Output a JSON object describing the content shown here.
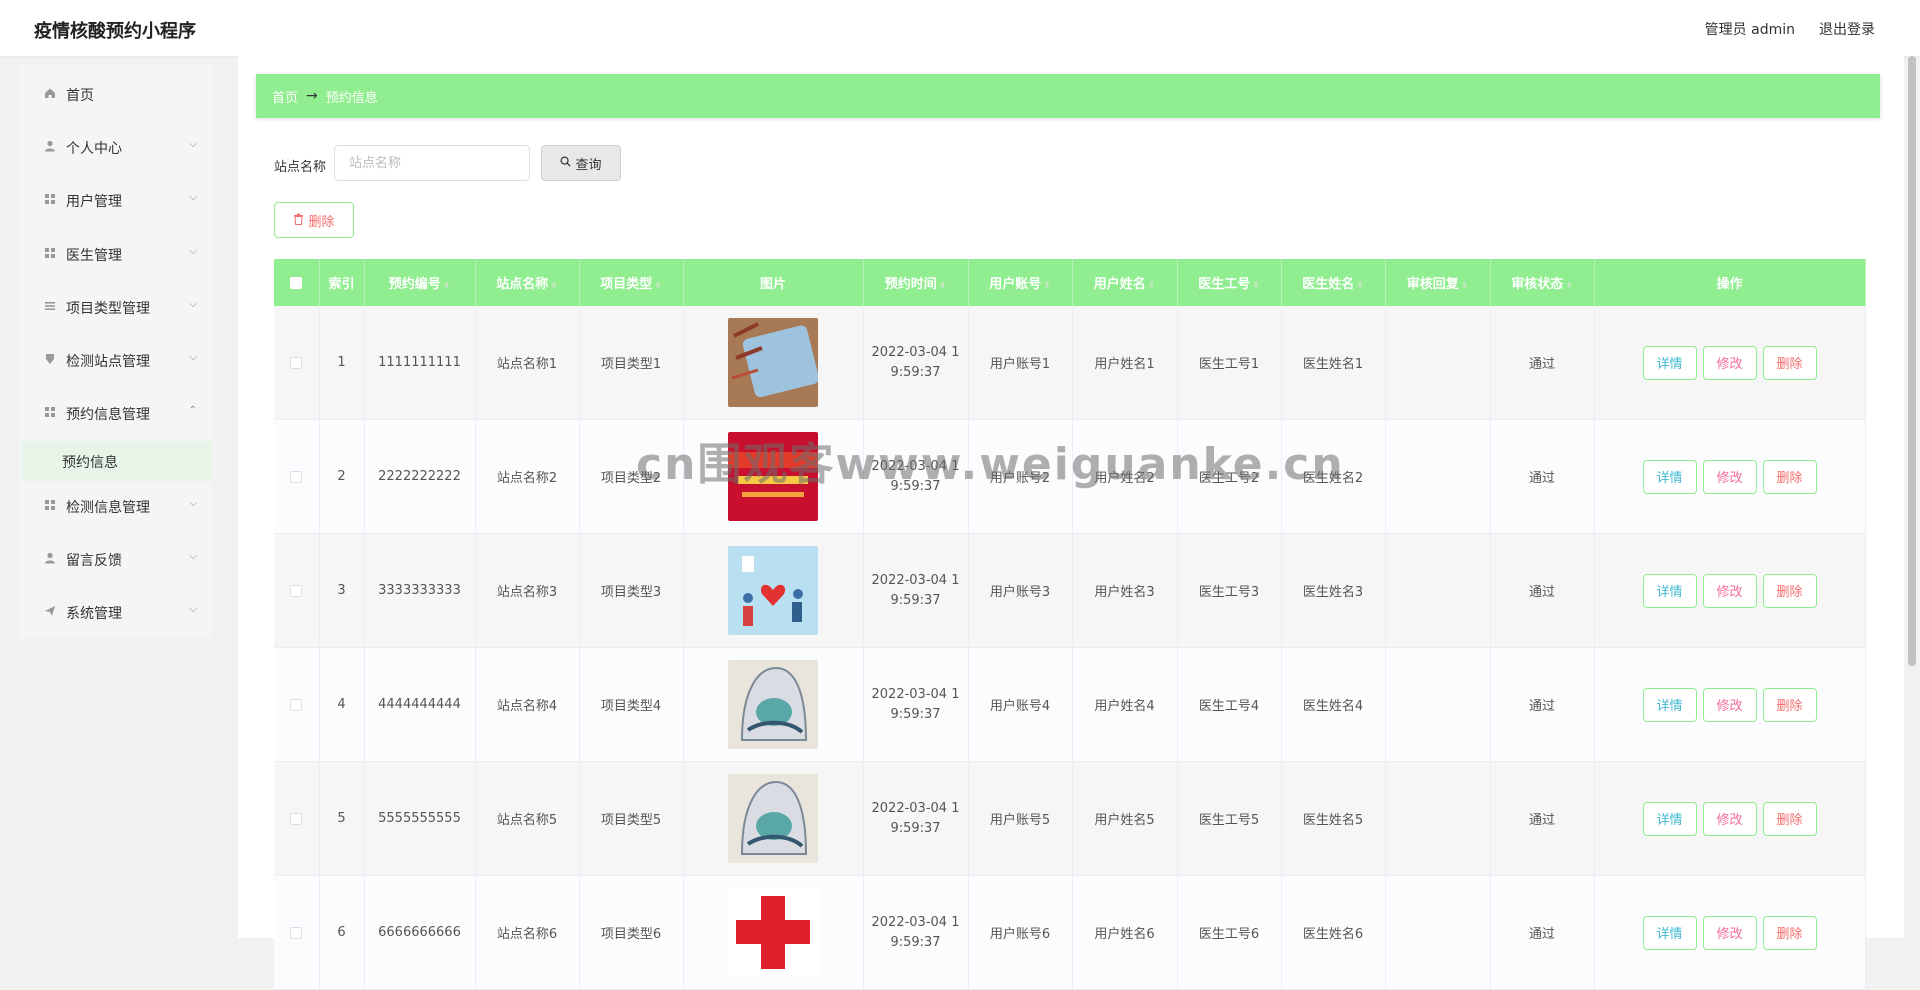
{
  "app_title": "疫情核酸预约小程序",
  "header": {
    "user": "管理员 admin",
    "logout": "退出登录"
  },
  "sidebar": {
    "items": [
      {
        "label": "首页",
        "icon": "home-icon"
      },
      {
        "label": "个人中心",
        "icon": "user-icon"
      },
      {
        "label": "用户管理",
        "icon": "grid-icon"
      },
      {
        "label": "医生管理",
        "icon": "grid-icon"
      },
      {
        "label": "项目类型管理",
        "icon": "list-icon"
      },
      {
        "label": "检测站点管理",
        "icon": "pin-icon"
      },
      {
        "label": "预约信息管理",
        "icon": "grid-icon"
      },
      {
        "label": "检测信息管理",
        "icon": "grid-icon"
      },
      {
        "label": "留言反馈",
        "icon": "user-icon"
      },
      {
        "label": "系统管理",
        "icon": "send-icon"
      }
    ],
    "active_sub": "预约信息"
  },
  "breadcrumb": {
    "home": "首页",
    "current": "预约信息"
  },
  "search": {
    "label": "站点名称",
    "placeholder": "站点名称",
    "button": "查询"
  },
  "toolbar": {
    "delete_label": "删除"
  },
  "table": {
    "headers": [
      "索引",
      "预约编号",
      "站点名称",
      "项目类型",
      "图片",
      "预约时间",
      "用户账号",
      "用户姓名",
      "医生工号",
      "医生姓名",
      "审核回复",
      "审核状态",
      "操作"
    ],
    "rows": [
      {
        "index": "1",
        "order_no": "1111111111",
        "site": "站点名称1",
        "type": "项目类型1",
        "time1": "2022-03-04 1",
        "time2": "9:59:37",
        "account": "用户账号1",
        "name": "用户姓名1",
        "doc_no": "医生工号1",
        "doc_name": "医生姓名1",
        "reply": "",
        "status": "通过"
      },
      {
        "index": "2",
        "order_no": "2222222222",
        "site": "站点名称2",
        "type": "项目类型2",
        "time1": "2022-03-04 1",
        "time2": "9:59:37",
        "account": "用户账号2",
        "name": "用户姓名2",
        "doc_no": "医生工号2",
        "doc_name": "医生姓名2",
        "reply": "",
        "status": "通过"
      },
      {
        "index": "3",
        "order_no": "3333333333",
        "site": "站点名称3",
        "type": "项目类型3",
        "time1": "2022-03-04 1",
        "time2": "9:59:37",
        "account": "用户账号3",
        "name": "用户姓名3",
        "doc_no": "医生工号3",
        "doc_name": "医生姓名3",
        "reply": "",
        "status": "通过"
      },
      {
        "index": "4",
        "order_no": "4444444444",
        "site": "站点名称4",
        "type": "项目类型4",
        "time1": "2022-03-04 1",
        "time2": "9:59:37",
        "account": "用户账号4",
        "name": "用户姓名4",
        "doc_no": "医生工号4",
        "doc_name": "医生姓名4",
        "reply": "",
        "status": "通过"
      },
      {
        "index": "5",
        "order_no": "5555555555",
        "site": "站点名称5",
        "type": "项目类型5",
        "time1": "2022-03-04 1",
        "time2": "9:59:37",
        "account": "用户账号5",
        "name": "用户姓名5",
        "doc_no": "医生工号5",
        "doc_name": "医生姓名5",
        "reply": "",
        "status": "通过"
      },
      {
        "index": "6",
        "order_no": "6666666666",
        "site": "站点名称6",
        "type": "项目类型6",
        "time1": "2022-03-04 1",
        "time2": "9:59:37",
        "account": "用户账号6",
        "name": "用户姓名6",
        "doc_no": "医生工号6",
        "doc_name": "医生姓名6",
        "reply": "",
        "status": "通过"
      }
    ],
    "actions": {
      "detail": "详情",
      "edit": "修改",
      "delete": "删除"
    }
  },
  "watermark": "cn围观客www.weiguanke.cn",
  "colors": {
    "accent": "#90ee90",
    "detail": "#3fb9d1",
    "edit": "#f56c9c",
    "delete": "#f56c6c"
  }
}
